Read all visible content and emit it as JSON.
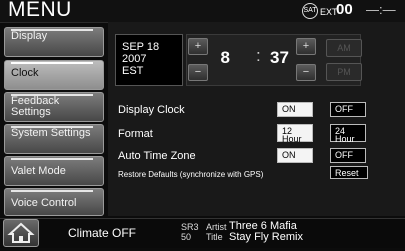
{
  "header": {
    "title": "MENU",
    "sat_icon_label": "SAT",
    "ext_label": "EXT",
    "ext_value": "00",
    "signal": "—:—"
  },
  "sidebar": {
    "items": [
      {
        "label": "Display"
      },
      {
        "label": "Clock"
      },
      {
        "label": "Feedback Settings"
      },
      {
        "label": "System Settings"
      },
      {
        "label": "Valet Mode"
      },
      {
        "label": "Voice Control"
      }
    ]
  },
  "clock": {
    "date_line1": "SEP 18",
    "date_line2": "2007",
    "date_line3": "EST",
    "hour": "8",
    "colon": ":",
    "minute": "37",
    "spin_up": "+",
    "spin_down": "−",
    "am": "AM",
    "pm": "PM"
  },
  "settings": {
    "display_clock": {
      "label": "Display Clock",
      "on": "ON",
      "off": "OFF"
    },
    "format": {
      "label": "Format",
      "opt12": "12 Hour",
      "opt24": "24 Hour"
    },
    "auto_tz": {
      "label": "Auto Time Zone",
      "on": "ON",
      "off": "OFF"
    },
    "restore": {
      "label": "Restore Defaults (synchronize with GPS)",
      "button": "Reset"
    }
  },
  "footer": {
    "climate": "Climate OFF",
    "src_label": "SR3",
    "src_channel": "50",
    "artist_label": "Artist",
    "title_label": "Title",
    "artist": "Three 6 Mafia",
    "title": "Stay Fly Remix"
  },
  "colors": {
    "active_tab": "#a8a8a8",
    "on_button": "#f4f4f4",
    "off_button": "#000000"
  }
}
